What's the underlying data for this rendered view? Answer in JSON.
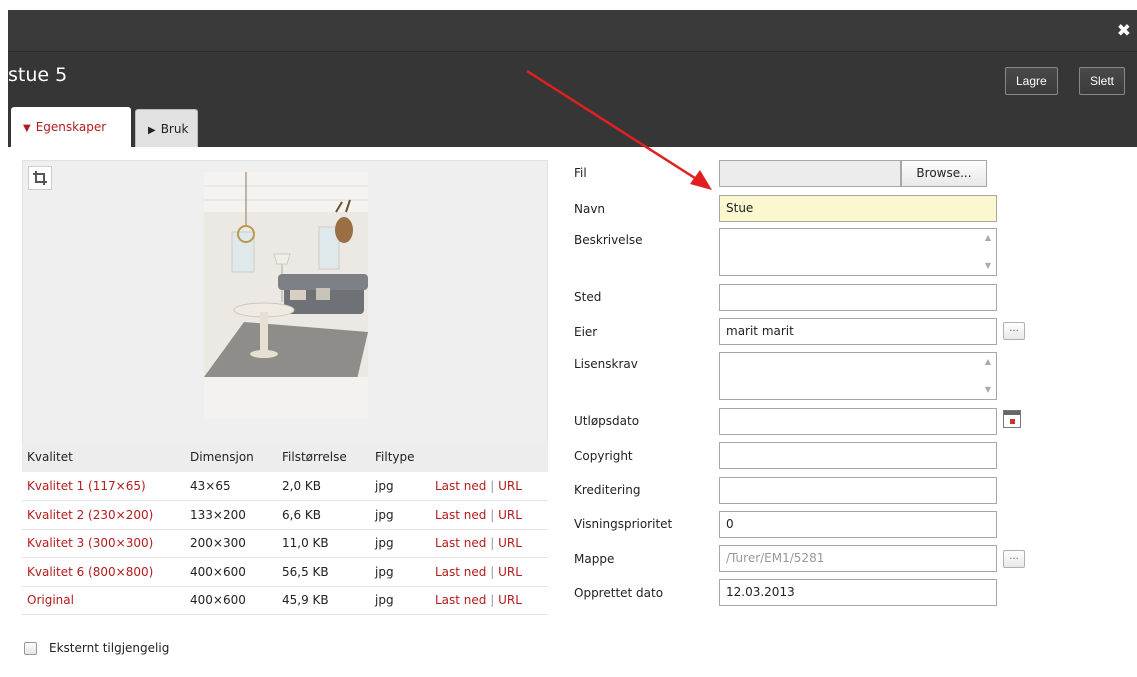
{
  "dialog": {
    "close_glyph": "✖",
    "title": "stue 5",
    "buttons": {
      "save": "Lagre",
      "delete": "Slett"
    },
    "tabs": [
      {
        "label": "Egenskaper",
        "active": true
      },
      {
        "label": "Bruk",
        "active": false
      }
    ]
  },
  "quality_table": {
    "headers": [
      "Kvalitet",
      "Dimensjon",
      "Filstørrelse",
      "Filtype"
    ],
    "rows": [
      {
        "quality": "Kvalitet 1 (117×65)",
        "dimension": "43×65",
        "size": "2,0 KB",
        "type": "jpg"
      },
      {
        "quality": "Kvalitet 2 (230×200)",
        "dimension": "133×200",
        "size": "6,6 KB",
        "type": "jpg"
      },
      {
        "quality": "Kvalitet 3 (300×300)",
        "dimension": "200×300",
        "size": "11,0 KB",
        "type": "jpg"
      },
      {
        "quality": "Kvalitet 6 (800×800)",
        "dimension": "400×600",
        "size": "56,5 KB",
        "type": "jpg"
      },
      {
        "quality": "Original",
        "dimension": "400×600",
        "size": "45,9 KB",
        "type": "jpg"
      }
    ],
    "download_label": "Last ned",
    "url_label": "URL",
    "separator": "|"
  },
  "external": {
    "label": "Eksternt tilgjengelig",
    "checked": false
  },
  "form": {
    "fil_label": "Fil",
    "browse_label": "Browse...",
    "navn_label": "Navn",
    "navn_value": "Stue",
    "beskrivelse_label": "Beskrivelse",
    "sted_label": "Sted",
    "eier_label": "Eier",
    "eier_value": "marit marit",
    "lisenskrav_label": "Lisenskrav",
    "utlopsdato_label": "Utløpsdato",
    "copyright_label": "Copyright",
    "kreditering_label": "Kreditering",
    "visningsprioritet_label": "Visningsprioritet",
    "visningsprioritet_value": "0",
    "mappe_label": "Mappe",
    "mappe_value": "/Turer/EM1/5281",
    "opprettet_label": "Opprettet dato",
    "opprettet_value": "12.03.2013",
    "dots_label": "...",
    "scroll_up": "▲",
    "scroll_down": "▼"
  },
  "colors": {
    "accent_red": "#b31c1c",
    "header_dark": "#363636",
    "highlight_field": "#fbf7cf"
  }
}
